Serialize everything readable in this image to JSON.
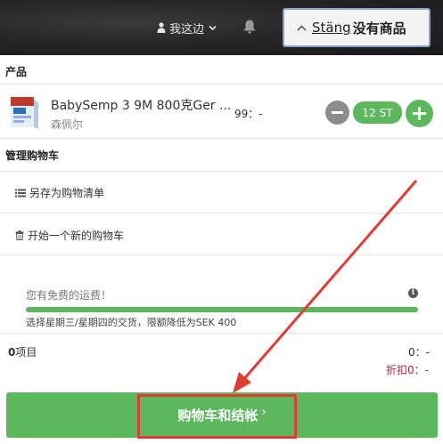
{
  "header": {
    "user_label": "我这边",
    "cart_close": "Stäng",
    "cart_empty": "没有商品"
  },
  "sections": {
    "products": "产品",
    "manage_cart": "管理购物车"
  },
  "product": {
    "name": "BabySemp 3 9M 800克Ger ...",
    "brand": "森佩尔",
    "price": "99：-",
    "quantity": "12 ST"
  },
  "actions": {
    "save_list": "另存为购物清单",
    "new_cart": "开始一个新的购物车"
  },
  "shipping": {
    "title": "您有免费的运费！",
    "progress_fraction": 1.0,
    "note": "选择星期三/星期四的交货，限额降低为SEK 400"
  },
  "totals": {
    "items_count": "0",
    "items_label": "项目",
    "total_value": "0：-",
    "discount_label": "折扣",
    "discount_value": "0：-"
  },
  "checkout": {
    "label": "购物车和结帐"
  },
  "colors": {
    "accent_green": "#5cb85c",
    "annotation_red": "#e23b33",
    "header_bg": "#262626",
    "discount_red": "#b5233b"
  },
  "icons": [
    "user-icon",
    "chevron-down-icon",
    "bell-icon",
    "chevron-up-icon",
    "minus-icon",
    "plus-icon",
    "list-icon",
    "trash-icon",
    "info-icon",
    "chevron-right-icon"
  ]
}
